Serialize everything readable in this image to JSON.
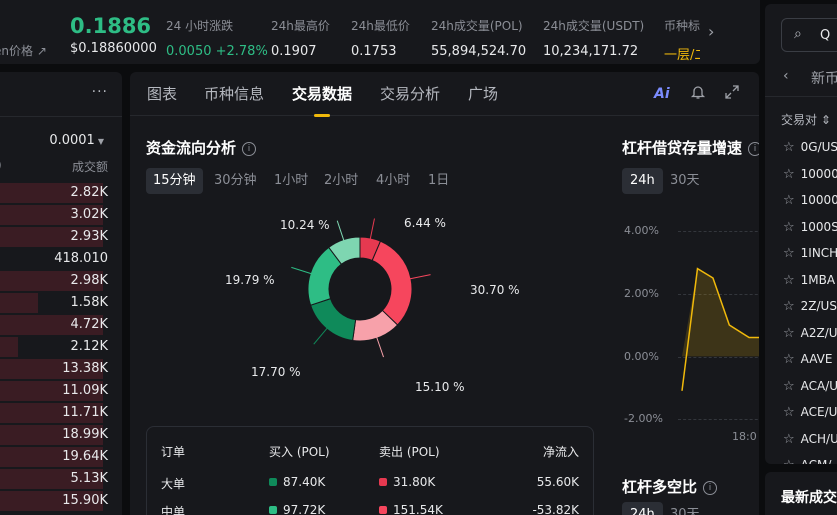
{
  "ticker": {
    "coin_title": "en价格",
    "price": "0.1886",
    "fiat_price": "$0.18860000",
    "stats": [
      {
        "label": "24 小时涨跌",
        "value": "0.0050 +2.78%",
        "color": "green"
      },
      {
        "label": "24h最高价",
        "value": "0.1907",
        "color": "normal"
      },
      {
        "label": "24h最低价",
        "value": "0.1753",
        "color": "normal"
      },
      {
        "label": "24h成交量(POL)",
        "value": "55,894,524.70",
        "color": "normal"
      },
      {
        "label": "24h成交量(USDT)",
        "value": "10,234,171.72",
        "color": "normal"
      },
      {
        "label": "币种标签",
        "value": "一层/二层",
        "color": "gold"
      }
    ]
  },
  "orderbook": {
    "precision": "0.0001",
    "col_left": ")",
    "col_amount": "成交额",
    "rows": [
      {
        "amount": "2.82K",
        "depth": 0.95
      },
      {
        "amount": "3.02K",
        "depth": 0.95
      },
      {
        "amount": "2.93K",
        "depth": 0.95
      },
      {
        "amount": "418.010",
        "depth": 0.0
      },
      {
        "amount": "2.98K",
        "depth": 0.95
      },
      {
        "amount": "1.58K",
        "depth": 0.35
      },
      {
        "amount": "4.72K",
        "depth": 0.95
      },
      {
        "amount": "2.12K",
        "depth": 0.17
      },
      {
        "amount": "13.38K",
        "depth": 0.95
      },
      {
        "amount": "11.09K",
        "depth": 0.95
      },
      {
        "amount": "11.71K",
        "depth": 0.95
      },
      {
        "amount": "18.99K",
        "depth": 0.95
      },
      {
        "amount": "19.64K",
        "depth": 0.95
      },
      {
        "amount": "5.13K",
        "depth": 0.95
      },
      {
        "amount": "15.90K",
        "depth": 0.95
      }
    ]
  },
  "tabs": [
    "图表",
    "币种信息",
    "交易数据",
    "交易分析",
    "广场"
  ],
  "active_tab": 2,
  "ai_label": "Ai",
  "fund_flow": {
    "title": "资金流向分析",
    "periods": [
      "15分钟",
      "30分钟",
      "1小时",
      "2小时",
      "4小时",
      "1日"
    ],
    "active_period": 0,
    "slices": [
      {
        "label": "6.44 %",
        "value": 6.44,
        "color": "#e63950"
      },
      {
        "label": "30.70 %",
        "value": 30.7,
        "color": "#f6465d"
      },
      {
        "label": "15.10 %",
        "value": 15.1,
        "color": "#f7a1aa"
      },
      {
        "label": "17.70 %",
        "value": 17.7,
        "color": "#0f8a5a"
      },
      {
        "label": "19.79 %",
        "value": 19.79,
        "color": "#2ebd85"
      },
      {
        "label": "10.24 %",
        "value": 10.24,
        "color": "#7ed6b1"
      }
    ],
    "table": {
      "headers": [
        "订单",
        "买入 (POL)",
        "卖出 (POL)",
        "净流入"
      ],
      "rows": [
        {
          "name": "大单",
          "buy": "87.40K",
          "sell": "31.80K",
          "net": "55.60K"
        },
        {
          "name": "中单",
          "buy": "97.72K",
          "sell": "151.54K",
          "net": "-53.82K"
        }
      ],
      "buy_color": "#0f8a5a",
      "sell_color": "#e63950"
    }
  },
  "chart_data": {
    "type": "area",
    "title": "杠杆借贷存量增速",
    "periods": [
      "24h",
      "30天"
    ],
    "active_period": 0,
    "y_ticks": [
      "4.00%",
      "2.00%",
      "0.00%",
      "-2.00%"
    ],
    "ylim": [
      -2,
      4
    ],
    "x_ticks": [
      "18:0"
    ],
    "y": [
      -1.1,
      2.8,
      2.5,
      1.0,
      0.6,
      0.6
    ],
    "color": "#f0b90b"
  },
  "long_short": {
    "title": "杠杆多空比",
    "periods": [
      "24h",
      "30天"
    ]
  },
  "market": {
    "search_placeholder": "Q",
    "nav_label": "新币",
    "col_header": "交易对",
    "pairs": [
      "0G/US",
      "10000",
      "10000",
      "1000S",
      "1INCH",
      "1MBA",
      "2Z/US",
      "A2Z/U",
      "AAVE",
      "ACA/U",
      "ACE/U",
      "ACH/U",
      "ACM/"
    ]
  },
  "latest_trades": {
    "title": "最新成交"
  }
}
